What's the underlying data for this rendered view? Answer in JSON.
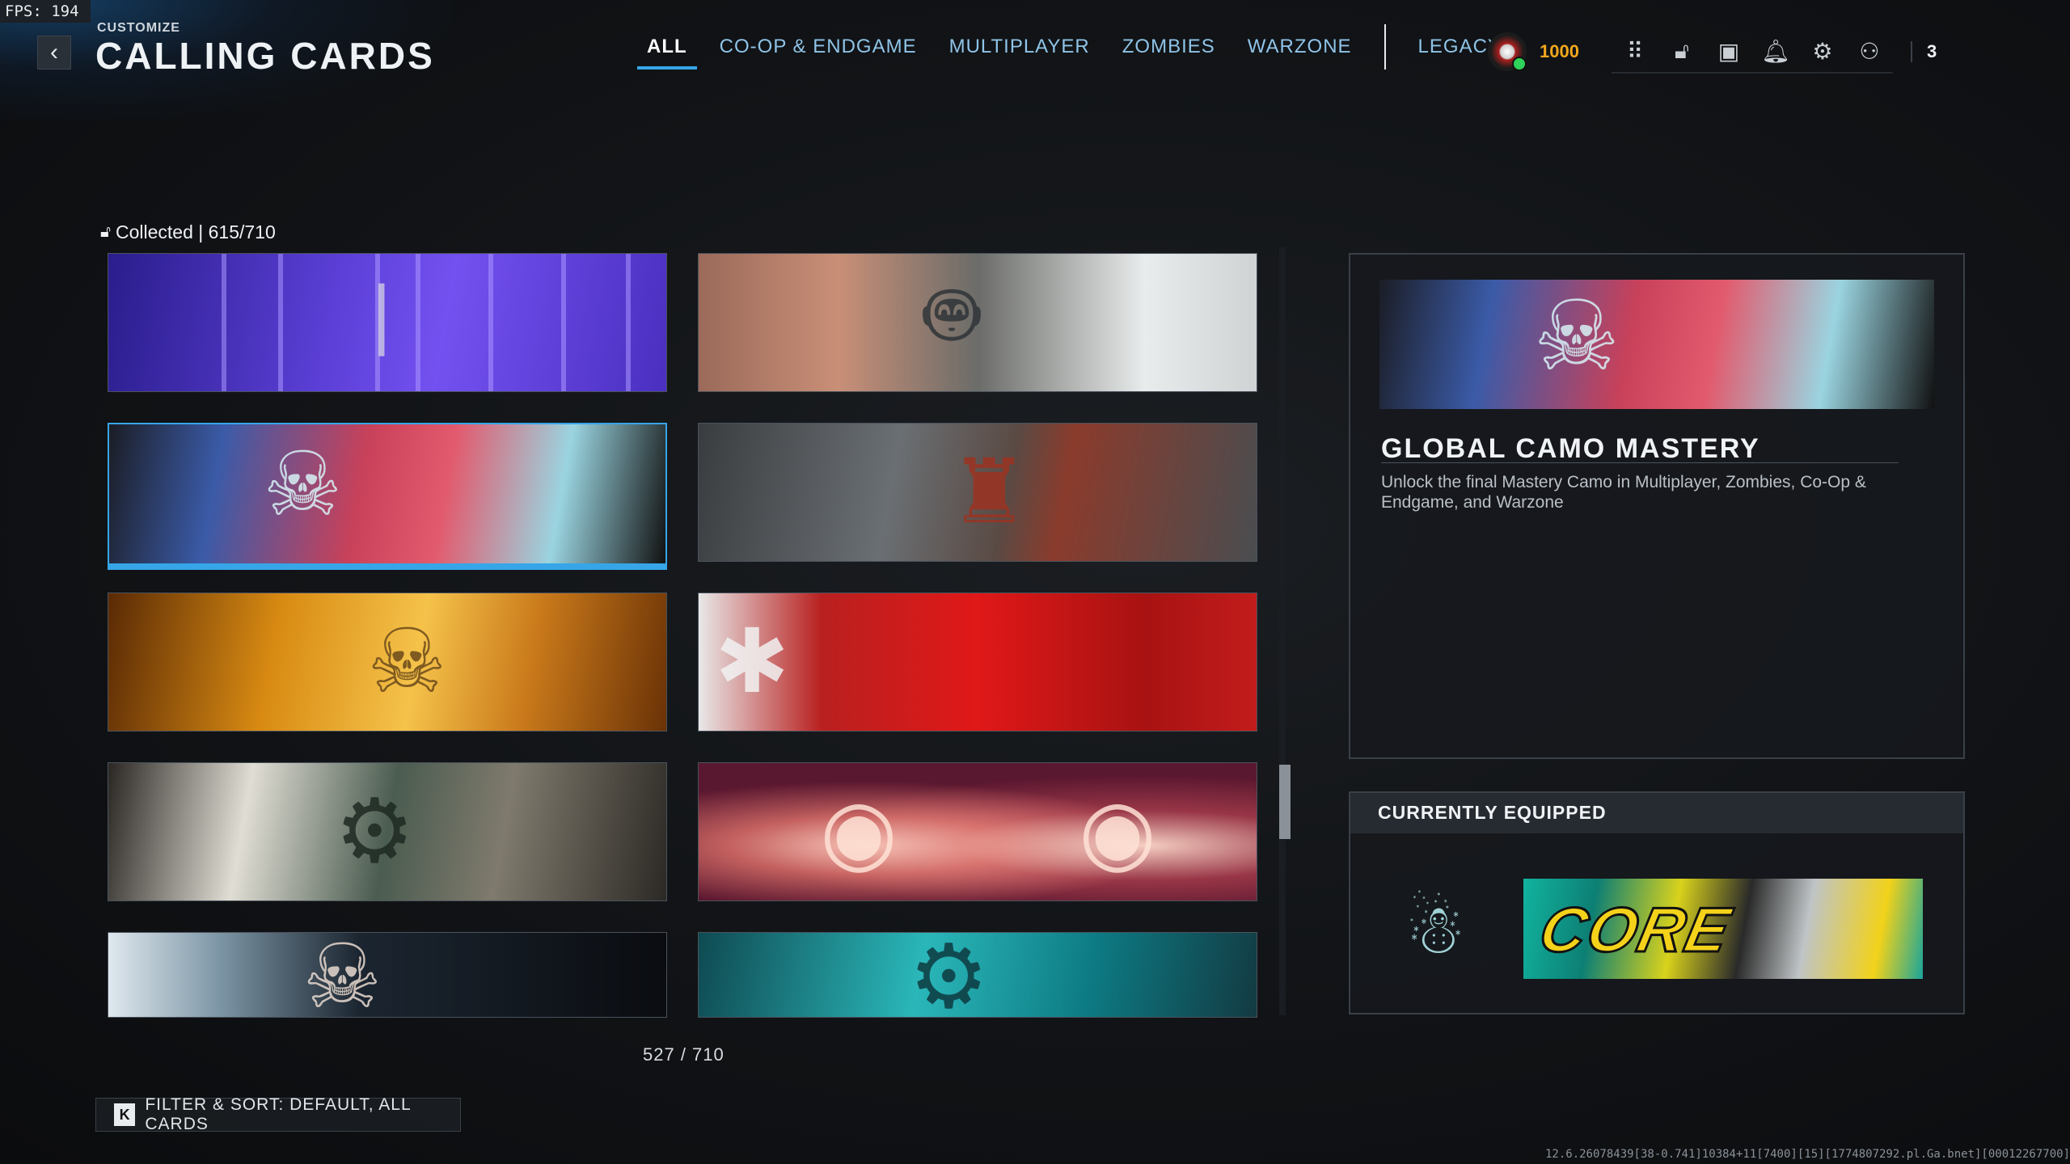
{
  "debug": {
    "fps": "FPS: 194",
    "version_string": "12.6.26078439[38-0.741]10384+11[7400][15][1774807292.pl.Ga.bnet][00012267700]"
  },
  "header": {
    "crumb": "CUSTOMIZE",
    "title": "CALLING CARDS",
    "back_icon": "chevron-left-icon"
  },
  "tabs": [
    {
      "label": "ALL",
      "active": true
    },
    {
      "label": "CO-OP & ENDGAME"
    },
    {
      "label": "MULTIPLAYER"
    },
    {
      "label": "ZOMBIES"
    },
    {
      "label": "WARZONE"
    },
    {
      "label": "LEGACY"
    }
  ],
  "hud": {
    "points": "1000",
    "friends_count": "3",
    "accent": "#f2a81c"
  },
  "grid": {
    "collected_label": "Collected | 615/710",
    "counter": "527 / 710",
    "cards": [
      {
        "art": "purple-feather-card"
      },
      {
        "art": "mech-robot-desert-card"
      },
      {
        "art": "neon-skull-gunner-card",
        "selected": true
      },
      {
        "art": "red-soldier-scope-card"
      },
      {
        "art": "golden-skull-card"
      },
      {
        "art": "red-wasp-card"
      },
      {
        "art": "mech-collage-card"
      },
      {
        "art": "glowing-eyes-card"
      },
      {
        "art": "skull-pistol-card"
      },
      {
        "art": "teal-mech-card"
      }
    ]
  },
  "filter": {
    "key": "K",
    "label": "FILTER & SORT: DEFAULT, ALL CARDS"
  },
  "detail": {
    "title": "GLOBAL CAMO MASTERY",
    "description": "Unlock the final Mastery Camo in Multiplayer, Zombies, Co-Op & Endgame, and Warzone"
  },
  "equipped": {
    "title": "CURRENTLY EQUIPPED",
    "card_text": "CORE"
  },
  "colors": {
    "accent_blue": "#36a6e8",
    "tab_blue": "#8fc4e8"
  }
}
